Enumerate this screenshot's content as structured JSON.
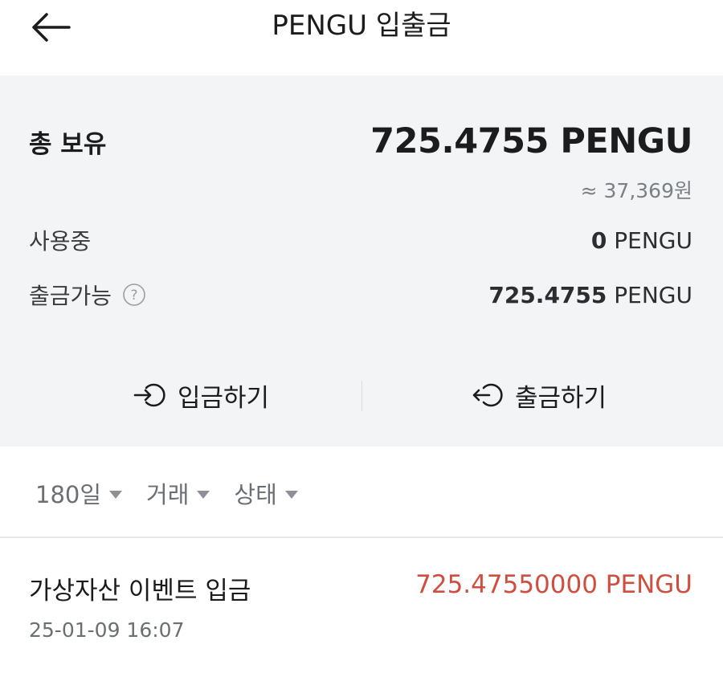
{
  "header": {
    "title": "PENGU 입출금"
  },
  "summary": {
    "total_label": "총 보유",
    "total_value": "725.4755 PENGU",
    "total_krw": "≈ 37,369원",
    "in_use_label": "사용중",
    "in_use_amount": "0",
    "in_use_unit": " PENGU",
    "withdrawable_label": "출금가능",
    "withdrawable_amount": "725.4755",
    "withdrawable_unit": " PENGU"
  },
  "actions": {
    "deposit_label": "입금하기",
    "withdraw_label": "출금하기"
  },
  "filters": [
    {
      "label": "180일"
    },
    {
      "label": "거래"
    },
    {
      "label": "상태"
    }
  ],
  "transactions": [
    {
      "title": "가상자산 이벤트 입금",
      "amount": "725.47550000 PENGU",
      "date": "25-01-09 16:07",
      "amount_color": "#cf4e3f"
    }
  ]
}
